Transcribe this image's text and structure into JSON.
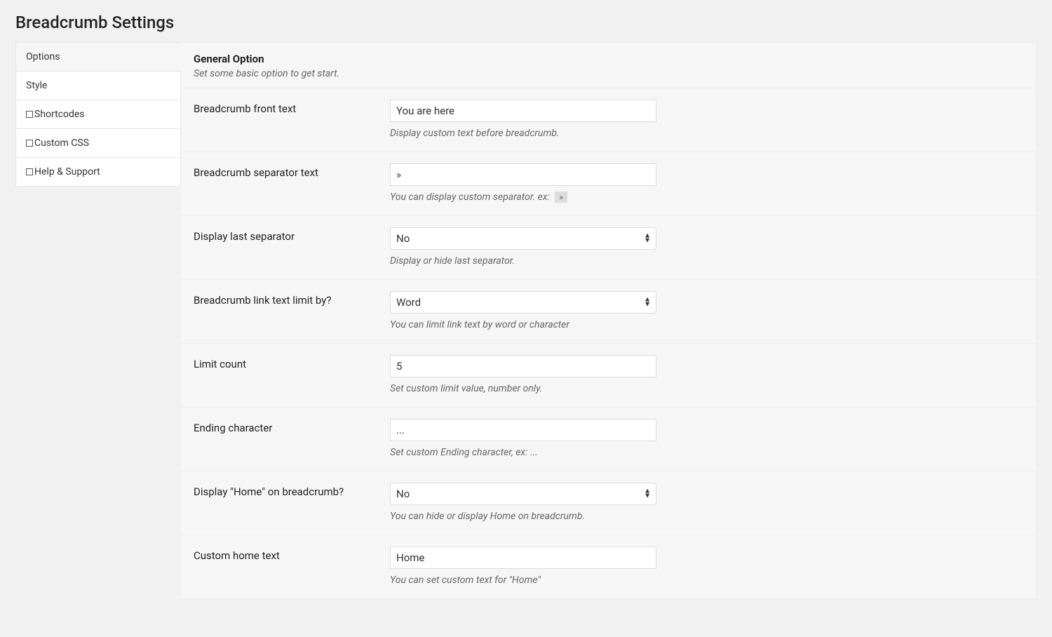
{
  "page": {
    "title": "Breadcrumb Settings"
  },
  "tabs": {
    "items": [
      {
        "label": "Options",
        "icon": false
      },
      {
        "label": "Style",
        "icon": false
      },
      {
        "label": "Shortcodes",
        "icon": true
      },
      {
        "label": "Custom CSS",
        "icon": true
      },
      {
        "label": "Help & Support",
        "icon": true
      }
    ],
    "active_index": 0
  },
  "section": {
    "title": "General Option",
    "description": "Set some basic option to get start."
  },
  "fields": {
    "front_text": {
      "label": "Breadcrumb front text",
      "value": "You are here",
      "help": "Display custom text before breadcrumb."
    },
    "separator_text": {
      "label": "Breadcrumb separator text",
      "value": "»",
      "help_prefix": "You can display custom separator. ex:",
      "help_chip": "»"
    },
    "last_separator": {
      "label": "Display last separator",
      "value": "No",
      "help": "Display or hide last separator."
    },
    "limit_by": {
      "label": "Breadcrumb link text limit by?",
      "value": "Word",
      "help": "You can limit link text by word or character"
    },
    "limit_count": {
      "label": "Limit count",
      "value": "5",
      "help": "Set custom limit value, number only."
    },
    "ending_char": {
      "label": "Ending character",
      "value": "...",
      "help": "Set custom Ending character, ex: ..."
    },
    "display_home": {
      "label": "Display \"Home\" on breadcrumb?",
      "value": "No",
      "help": "You can hide or display Home on breadcrumb."
    },
    "home_text": {
      "label": "Custom home text",
      "value": "Home",
      "help": "You can set custom text for \"Home\""
    }
  }
}
